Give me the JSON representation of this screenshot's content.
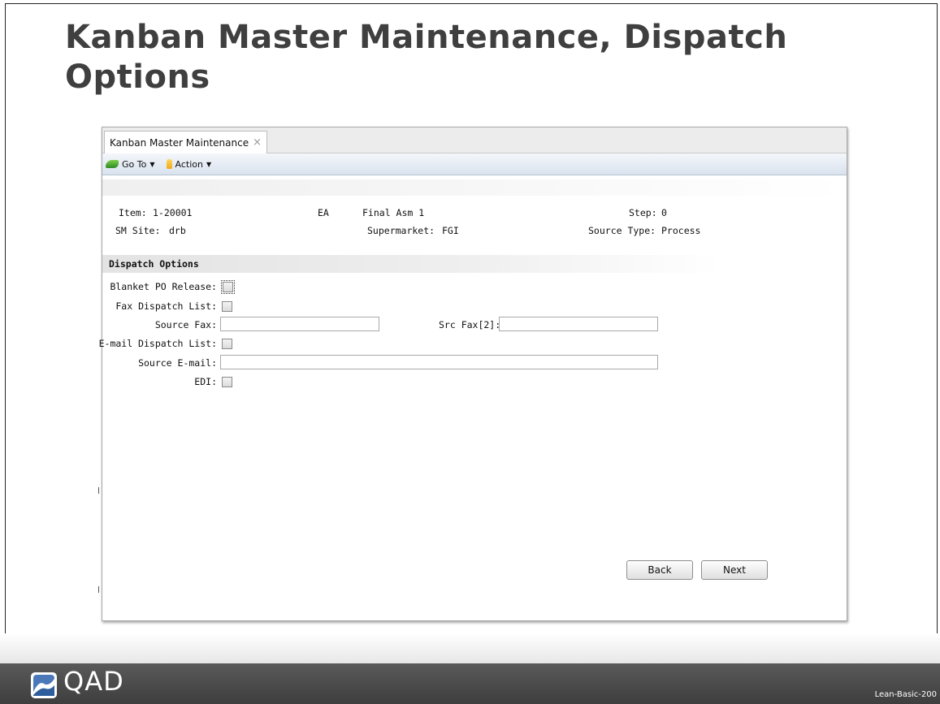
{
  "slide": {
    "title": "Kanban Master Maintenance, Dispatch Options",
    "footer_logo_text": "QAD",
    "footer_code": "Lean-Basic-200"
  },
  "window": {
    "tab_label": "Kanban Master Maintenance",
    "tab_close_icon": "×",
    "toolbar": {
      "goto_label": "Go To",
      "action_label": "Action",
      "caret": "▼"
    }
  },
  "header_info": {
    "item_label": "Item:",
    "item_value": "1-20001",
    "um_value": "EA",
    "description_value": "Final Asm 1",
    "step_label": "Step:",
    "step_value": "0",
    "site_label": "SM Site:",
    "site_value": "drb",
    "supermarket_label": "Supermarket:",
    "supermarket_value": "FGI",
    "source_type_label": "Source Type:",
    "source_type_value": "Process"
  },
  "dispatch": {
    "section_title": "Dispatch Options",
    "blanket_po_label": "Blanket PO Release:",
    "blanket_po_checked": false,
    "fax_list_label": "Fax Dispatch List:",
    "fax_list_checked": false,
    "source_fax_label": "Source Fax:",
    "source_fax_value": "",
    "src_fax2_label": "Src Fax[2]:",
    "src_fax2_value": "",
    "email_list_label": "E-mail Dispatch List:",
    "email_list_checked": false,
    "source_email_label": "Source E-mail:",
    "source_email_value": "",
    "edi_label": "EDI:",
    "edi_checked": false
  },
  "buttons": {
    "back_label": "Back",
    "next_label": "Next"
  }
}
